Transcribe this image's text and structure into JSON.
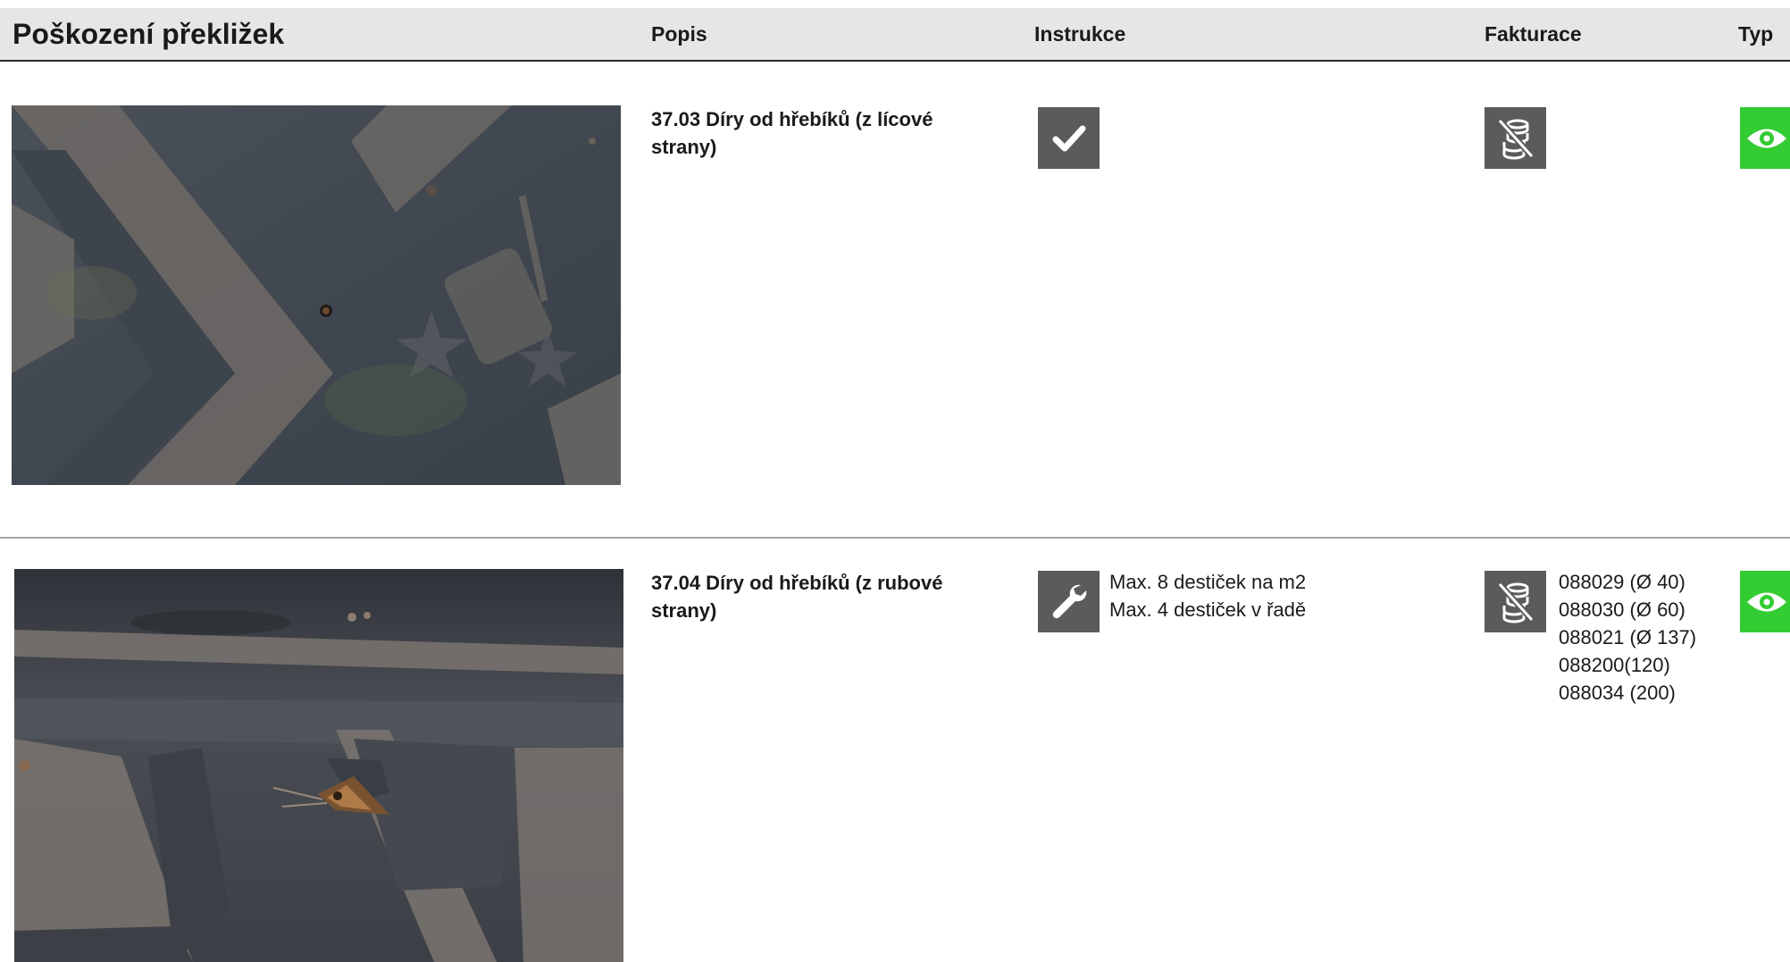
{
  "header": {
    "title": "Poškození překližek",
    "columns": [
      "Popis",
      "Instrukce",
      "Fakturace",
      "Typ"
    ]
  },
  "rows": [
    {
      "photo_icon": "plywood-photo-nail-holes-face",
      "description": [
        "37.03 Díry od hřebíků (z lícové",
        "strany)"
      ],
      "instruction_icon": "checkmark-icon",
      "instruction_lines": [],
      "billing_icon": "coins-crossed-icon",
      "billing_lines": [],
      "type_icon": "eye-icon"
    },
    {
      "photo_icon": "plywood-photo-nail-holes-back",
      "description": [
        "37.04 Díry od hřebíků (z rubové",
        "strany)"
      ],
      "instruction_icon": "wrench-icon",
      "instruction_lines": [
        "Max. 8 destiček na m2",
        "Max. 4 destiček v řadě"
      ],
      "billing_icon": "coins-crossed-icon",
      "billing_lines": [
        "088029 (Ø 40)",
        "088030 (Ø 60)",
        "088021 (Ø 137)",
        "088200(120)",
        "088034 (200)"
      ],
      "type_icon": "eye-icon"
    }
  ],
  "colors": {
    "header_bg": "#e6e6e6",
    "icon_bg": "#5b5b5b",
    "type_green": "#33cc33"
  }
}
